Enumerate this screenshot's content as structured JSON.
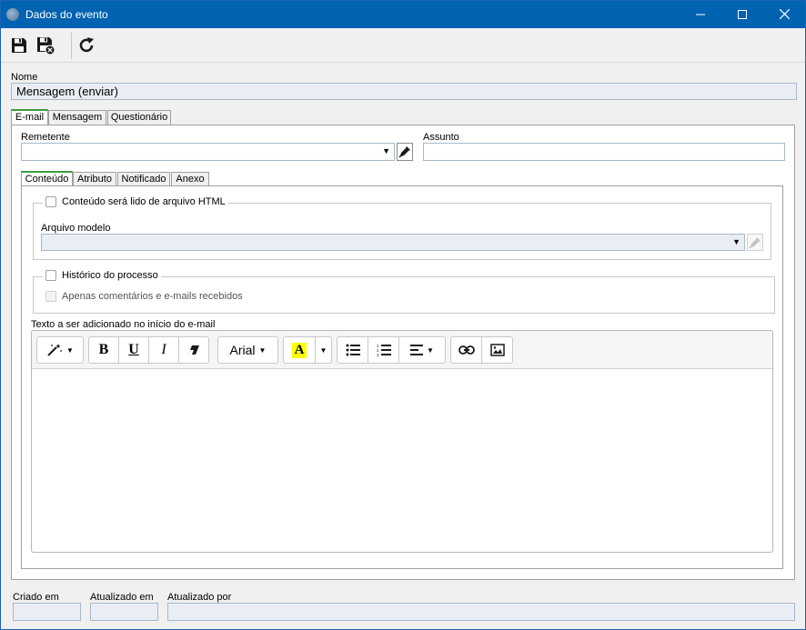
{
  "window": {
    "title": "Dados do evento"
  },
  "form": {
    "nome_label": "Nome",
    "nome_value": "Mensagem (enviar)",
    "tabs": [
      "E-mail",
      "Mensagem",
      "Questionário"
    ],
    "remetente_label": "Remetente",
    "remetente_value": "",
    "assunto_label": "Assunto",
    "assunto_value": "",
    "inner_tabs": [
      "Conteúdo",
      "Atributo",
      "Notificado",
      "Anexo"
    ],
    "html_checkbox_label": "Conteúdo será lido de arquivo HTML",
    "arquivo_modelo_label": "Arquivo modelo",
    "arquivo_modelo_value": "",
    "historico_label": "Histórico do processo",
    "apenas_label": "Apenas comentários e e-mails recebidos",
    "texto_label": "Texto a ser adicionado no início do e-mail",
    "editor": {
      "font": "Arial",
      "bold": "B",
      "underline": "U",
      "italic": "I",
      "highlight": "A",
      "content": ""
    }
  },
  "footer": {
    "criado_em_label": "Criado em",
    "atualizado_em_label": "Atualizado em",
    "atualizado_por_label": "Atualizado por",
    "criado_em_value": "",
    "atualizado_em_value": "",
    "atualizado_por_value": ""
  },
  "colors": {
    "titlebar": "#0063b1",
    "active_tab": "#3c9e3c",
    "highlight": "#ffff00"
  }
}
